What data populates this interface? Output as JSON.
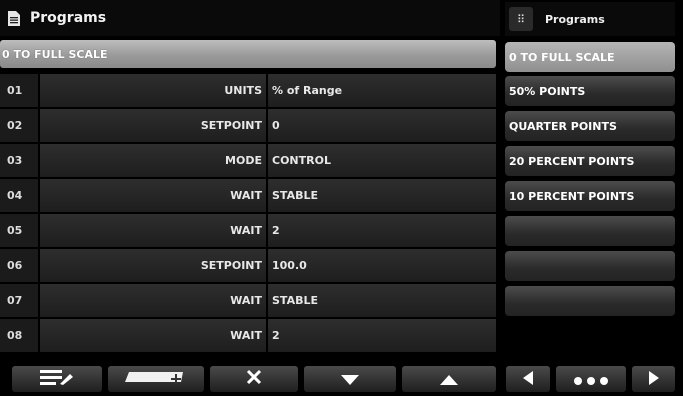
{
  "header": {
    "title": "Programs",
    "icon": "document-icon"
  },
  "program": {
    "name": "0 TO FULL SCALE"
  },
  "steps": [
    {
      "num": "01",
      "command": "UNITS",
      "value": "% of Range"
    },
    {
      "num": "02",
      "command": "SETPOINT",
      "value": "0"
    },
    {
      "num": "03",
      "command": "MODE",
      "value": "CONTROL"
    },
    {
      "num": "04",
      "command": "WAIT",
      "value": "STABLE"
    },
    {
      "num": "05",
      "command": "WAIT",
      "value": "2"
    },
    {
      "num": "06",
      "command": "SETPOINT",
      "value": "100.0"
    },
    {
      "num": "07",
      "command": "WAIT",
      "value": "STABLE"
    },
    {
      "num": "08",
      "command": "WAIT",
      "value": "2"
    }
  ],
  "toolbar": {
    "edit_icon": "edit-list-icon",
    "insert_icon": "insert-step-icon",
    "delete_icon": "close-icon",
    "down_icon": "arrow-down-icon",
    "up_icon": "arrow-up-icon"
  },
  "sidebar": {
    "title": "Programs",
    "items": [
      {
        "label": "0 TO FULL SCALE",
        "selected": true
      },
      {
        "label": "50% POINTS",
        "selected": false
      },
      {
        "label": "QUARTER POINTS",
        "selected": false
      },
      {
        "label": "20 PERCENT POINTS",
        "selected": false
      },
      {
        "label": "10 PERCENT POINTS",
        "selected": false
      },
      {
        "label": "",
        "selected": false
      },
      {
        "label": "",
        "selected": false
      },
      {
        "label": "",
        "selected": false
      }
    ]
  },
  "pager": {
    "prev_icon": "arrow-left-icon",
    "more_icon": "more-dots-icon",
    "next_icon": "arrow-right-icon"
  },
  "colors": {
    "selected_bg": "#a8a8a8",
    "button_bg": "#2e2e2e",
    "background": "#000000"
  }
}
